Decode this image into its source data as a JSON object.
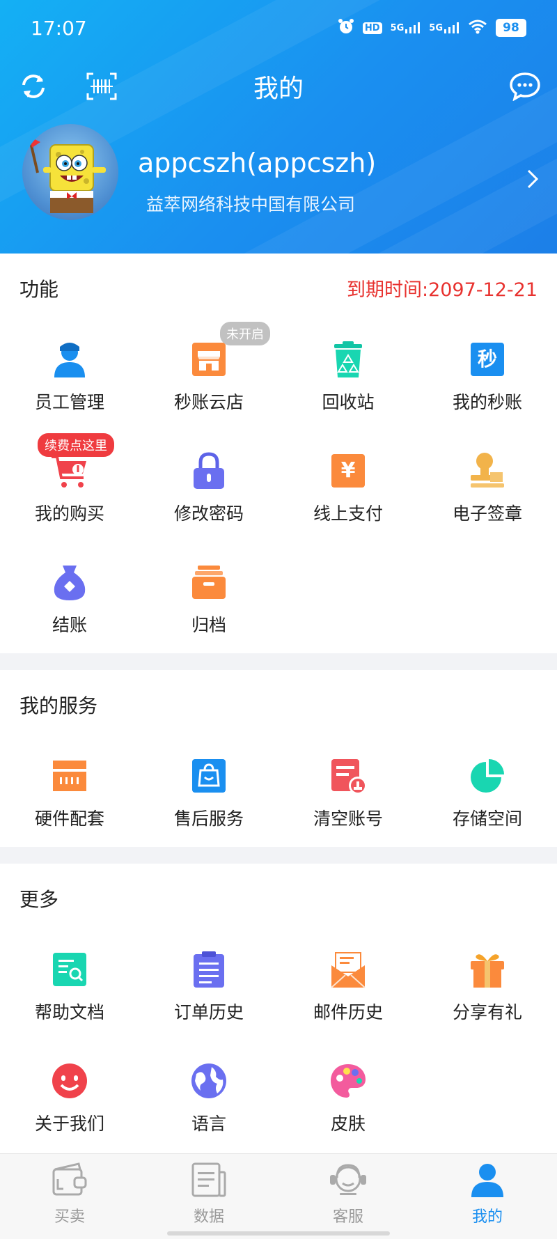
{
  "status_bar": {
    "time": "17:07",
    "network_1": "5G",
    "network_2": "5G",
    "hd": "HD",
    "battery": "98"
  },
  "header": {
    "title": "我的",
    "username": "appcszh(appcszh)",
    "company": "益萃网络科技中国有限公司"
  },
  "functions": {
    "title": "功能",
    "expiry": "到期时间:2097-12-21",
    "items": [
      {
        "label": "员工管理",
        "icon": "staff-icon"
      },
      {
        "label": "秒账云店",
        "icon": "store-icon",
        "badge": "未开启"
      },
      {
        "label": "回收站",
        "icon": "recycle-bin-icon"
      },
      {
        "label": "我的秒账",
        "icon": "miao-icon",
        "glyph": "秒"
      },
      {
        "label": "我的购买",
        "icon": "cart-icon",
        "badge": "续费点这里"
      },
      {
        "label": "修改密码",
        "icon": "lock-icon"
      },
      {
        "label": "线上支付",
        "icon": "yuan-icon",
        "glyph": "¥"
      },
      {
        "label": "电子签章",
        "icon": "seal-icon"
      },
      {
        "label": "结账",
        "icon": "money-bag-icon"
      },
      {
        "label": "归档",
        "icon": "archive-icon"
      }
    ]
  },
  "services": {
    "title": "我的服务",
    "items": [
      {
        "label": "硬件配套",
        "icon": "hardware-icon"
      },
      {
        "label": "售后服务",
        "icon": "shopping-bag-icon"
      },
      {
        "label": "清空账号",
        "icon": "clear-account-icon"
      },
      {
        "label": "存储空间",
        "icon": "pie-chart-icon"
      }
    ]
  },
  "more": {
    "title": "更多",
    "items": [
      {
        "label": "帮助文档",
        "icon": "help-doc-icon"
      },
      {
        "label": "订单历史",
        "icon": "order-history-icon"
      },
      {
        "label": "邮件历史",
        "icon": "mail-icon"
      },
      {
        "label": "分享有礼",
        "icon": "gift-icon"
      },
      {
        "label": "关于我们",
        "icon": "smile-icon"
      },
      {
        "label": "语言",
        "icon": "globe-icon"
      },
      {
        "label": "皮肤",
        "icon": "palette-icon"
      }
    ]
  },
  "tabs": [
    {
      "label": "买卖",
      "icon": "wallet-icon"
    },
    {
      "label": "数据",
      "icon": "data-icon"
    },
    {
      "label": "客服",
      "icon": "headset-icon"
    },
    {
      "label": "我的",
      "icon": "user-icon",
      "active": true
    }
  ],
  "colors": {
    "accent": "#1a8ff0",
    "header_start": "#14b0f4",
    "expiry_red": "#e8322f",
    "badge_red": "#ef3b3f"
  }
}
